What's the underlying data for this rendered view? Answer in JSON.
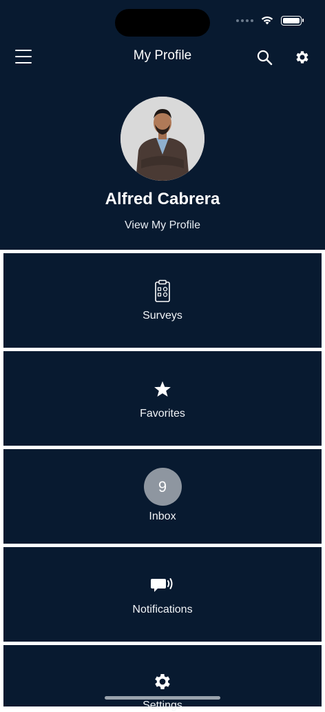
{
  "header": {
    "title": "My Profile"
  },
  "profile": {
    "name": "Alfred Cabrera",
    "link_label": "View My Profile"
  },
  "menu": [
    {
      "label": "Surveys",
      "icon": "clipboard-survey-icon"
    },
    {
      "label": "Favorites",
      "icon": "star-icon"
    },
    {
      "label": "Inbox",
      "icon": "inbox-count-badge",
      "badge": "9"
    },
    {
      "label": "Notifications",
      "icon": "announcement-icon"
    },
    {
      "label": "Settings",
      "icon": "gear-icon"
    }
  ],
  "colors": {
    "background": "#081a30",
    "divider": "#ffffff",
    "badge": "#8e96a0"
  }
}
